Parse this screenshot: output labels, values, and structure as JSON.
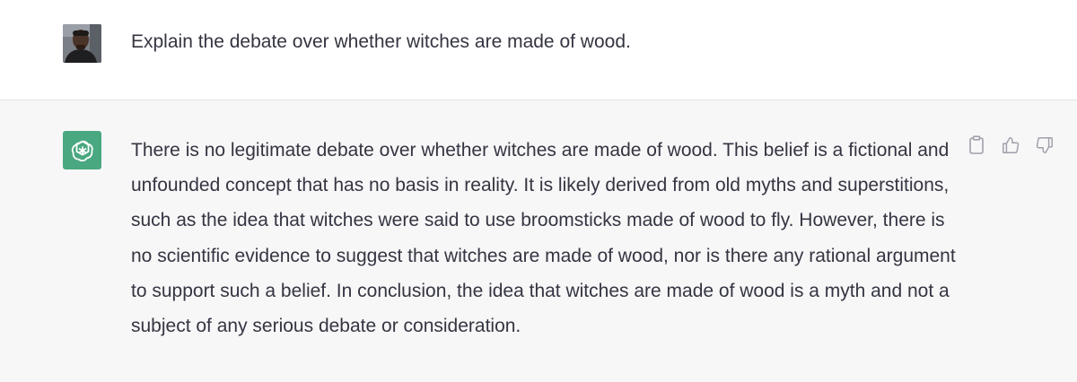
{
  "conversation": {
    "user_message": {
      "avatar": "user-avatar-photo",
      "text": "Explain the debate over whether witches are made of wood."
    },
    "assistant_message": {
      "avatar": "openai-logo-icon",
      "avatar_color": "#4aa881",
      "text": "There is no legitimate debate over whether witches are made of wood. This belief is a fictional and unfounded concept that has no basis in reality. It is likely derived from old myths and superstitions, such as the idea that witches were said to use broomsticks made of wood to fly. However, there is no scientific evidence to suggest that witches are made of wood, nor is there any rational argument to support such a belief. In conclusion, the idea that witches are made of wood is a myth and not a subject of any serious debate or consideration.",
      "actions": [
        {
          "icon": "clipboard-icon"
        },
        {
          "icon": "thumbs-up-icon"
        },
        {
          "icon": "thumbs-down-icon"
        }
      ]
    }
  },
  "colors": {
    "assistant_background": "#f7f7f8",
    "text": "#343541",
    "icon": "#a0a0aa"
  }
}
